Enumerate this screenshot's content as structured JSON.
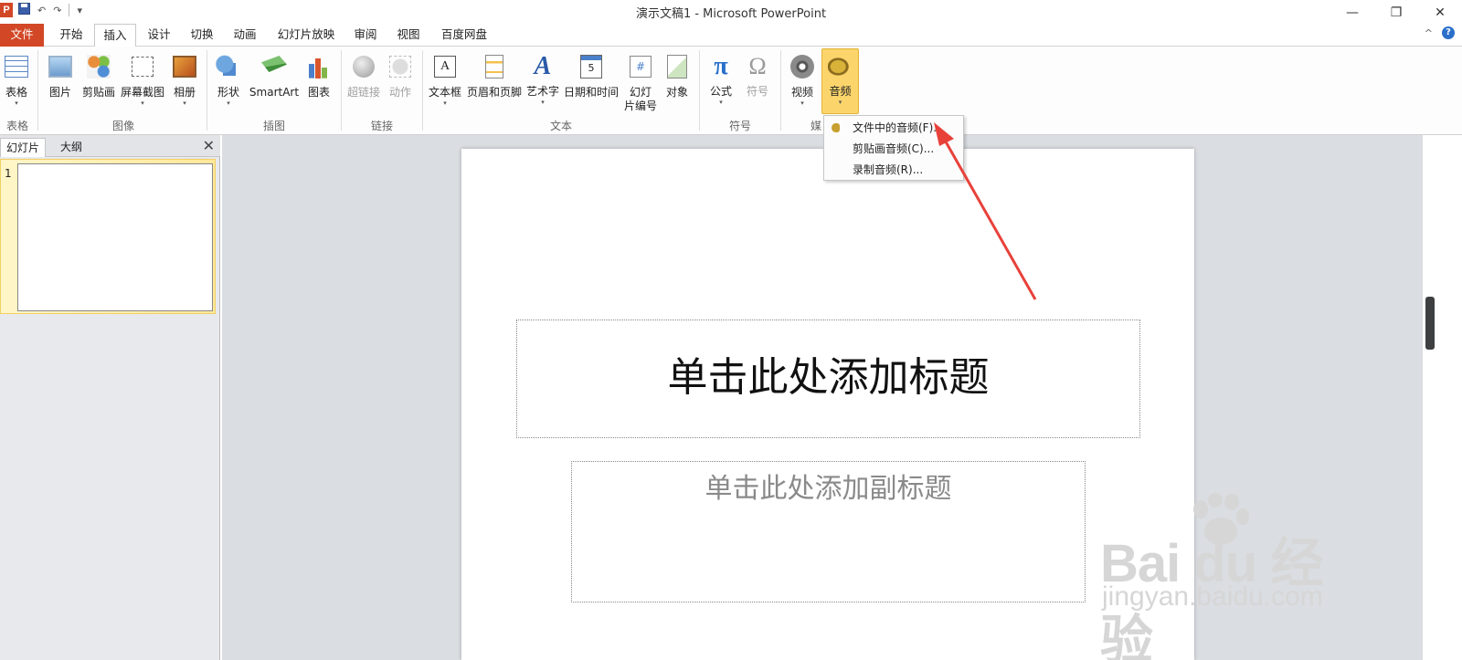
{
  "window": {
    "title": "演示文稿1 - Microsoft PowerPoint",
    "app_icon_letter": "P",
    "qat_undo": "↶",
    "qat_redo": "↷",
    "qat_customize": "▾",
    "min": "—",
    "restore": "❐",
    "close": "✕"
  },
  "tabs": {
    "file": "文件",
    "items": [
      "开始",
      "插入",
      "设计",
      "切换",
      "动画",
      "幻灯片放映",
      "审阅",
      "视图",
      "百度网盘"
    ],
    "collapse": "^",
    "help": "?"
  },
  "ribbon": {
    "buttons": {
      "table": "表格",
      "picture": "图片",
      "clipart": "剪贴画",
      "screenshot": "屏幕截图",
      "album": "相册",
      "shapes": "形状",
      "smartart": "SmartArt",
      "chart": "图表",
      "hyperlink": "超链接",
      "action": "动作",
      "textbox": "文本框",
      "header_footer": "页眉和页脚",
      "wordart": "艺术字",
      "datetime": "日期和时间",
      "slidenum_1": "幻灯",
      "slidenum_2": "片编号",
      "object": "对象",
      "equation": "公式",
      "symbol": "符号",
      "video": "视频",
      "audio": "音频"
    },
    "icon_text": {
      "textbox": "A",
      "wordart": "A",
      "date": "5",
      "slidenum": "#",
      "pi": "π",
      "omega": "Ω"
    },
    "groups": {
      "tables": "表格",
      "images": "图像",
      "illustrations": "插图",
      "links": "链接",
      "text": "文本",
      "symbols": "符号",
      "media": "媒"
    }
  },
  "panel": {
    "tab_slides": "幻灯片",
    "tab_outline": "大纲",
    "close": "✕",
    "slide_number": "1"
  },
  "slide": {
    "title_placeholder": "单击此处添加标题",
    "subtitle_placeholder": "单击此处添加副标题"
  },
  "audio_menu": {
    "items": [
      "文件中的音频(F)...",
      "剪贴画音频(C)...",
      "录制音频(R)..."
    ]
  },
  "watermark": {
    "brand": "Bai du 经验",
    "url": "jingyan.baidu.com"
  },
  "colors": {
    "file_tab": "#d24726",
    "active_button": "#fbd56b",
    "arrow": "#e8413a"
  }
}
